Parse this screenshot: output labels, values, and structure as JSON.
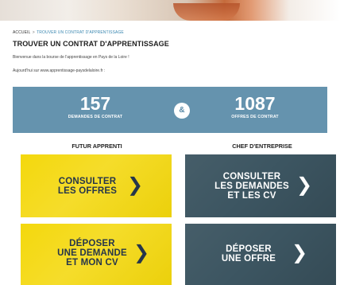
{
  "breadcrumb": {
    "home": "ACCUEIL",
    "separator": ">",
    "current": "TROUVER UN CONTRAT D'APPRENTISSAGE"
  },
  "page": {
    "title": "TROUVER UN CONTRAT D'APPRENTISSAGE",
    "intro": "Bienvenue dans la bourse de l'apprentissage en Pays de la Loire !",
    "site_line": "Aujourd'hui sur www.apprentissage-paysdelaloire.fr :"
  },
  "stats": {
    "left": {
      "number": "157",
      "label": "DEMANDES DE CONTRAT"
    },
    "separator": "&",
    "right": {
      "number": "1087",
      "label": "OFFRES DE CONTRAT"
    }
  },
  "columns": {
    "left": "FUTUR APPRENTI",
    "right": "CHEF D'ENTREPRISE"
  },
  "tiles": {
    "consult_offers": [
      "CONSULTER",
      "LES OFFRES"
    ],
    "consult_requests": [
      "CONSULTER",
      "LES DEMANDES",
      "ET LES CV"
    ],
    "post_request": [
      "DÉPOSER",
      "UNE DEMANDE",
      "ET MON CV"
    ],
    "post_offer": [
      "DÉPOSER",
      "UNE OFFRE"
    ]
  },
  "icons": {
    "arrow": "chevron-right-icon"
  },
  "colors": {
    "stats_band": "#6593ae",
    "yellow_tile": "#f4d80d",
    "dark_tile": "#3c5561",
    "yellow_text": "#26364a"
  }
}
